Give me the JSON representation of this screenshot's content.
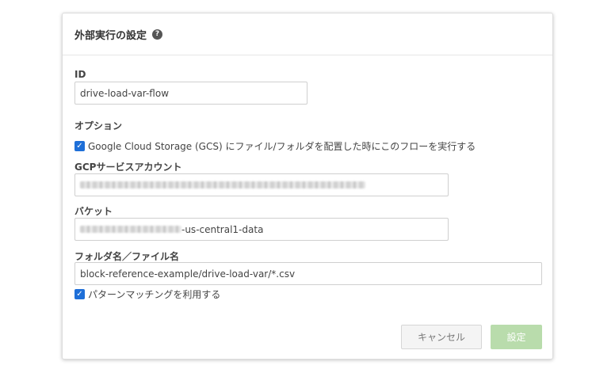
{
  "dialog": {
    "title": "外部実行の設定",
    "help_icon": "question-circle-icon",
    "id_label": "ID",
    "id_value": "drive-load-var-flow",
    "options_label": "オプション",
    "gcs_option": {
      "checked": true,
      "label": "Google Cloud Storage (GCS) にファイル/フォルダを配置した時にこのフローを実行する"
    },
    "service_account_label": "GCPサービスアカウント",
    "bucket_label": "バケット",
    "bucket_value_suffix": "-us-central1-data",
    "path_label": "フォルダ名／ファイル名",
    "path_value": "block-reference-example/drive-load-var/*.csv",
    "pattern_option": {
      "checked": true,
      "label": "パターンマッチングを利用する"
    },
    "cancel_label": "キャンセル",
    "submit_label": "設定"
  },
  "colors": {
    "checkbox": "#1e6fd8",
    "submit_button": "#b9dcac",
    "cancel_button": "#f4f4f4"
  }
}
